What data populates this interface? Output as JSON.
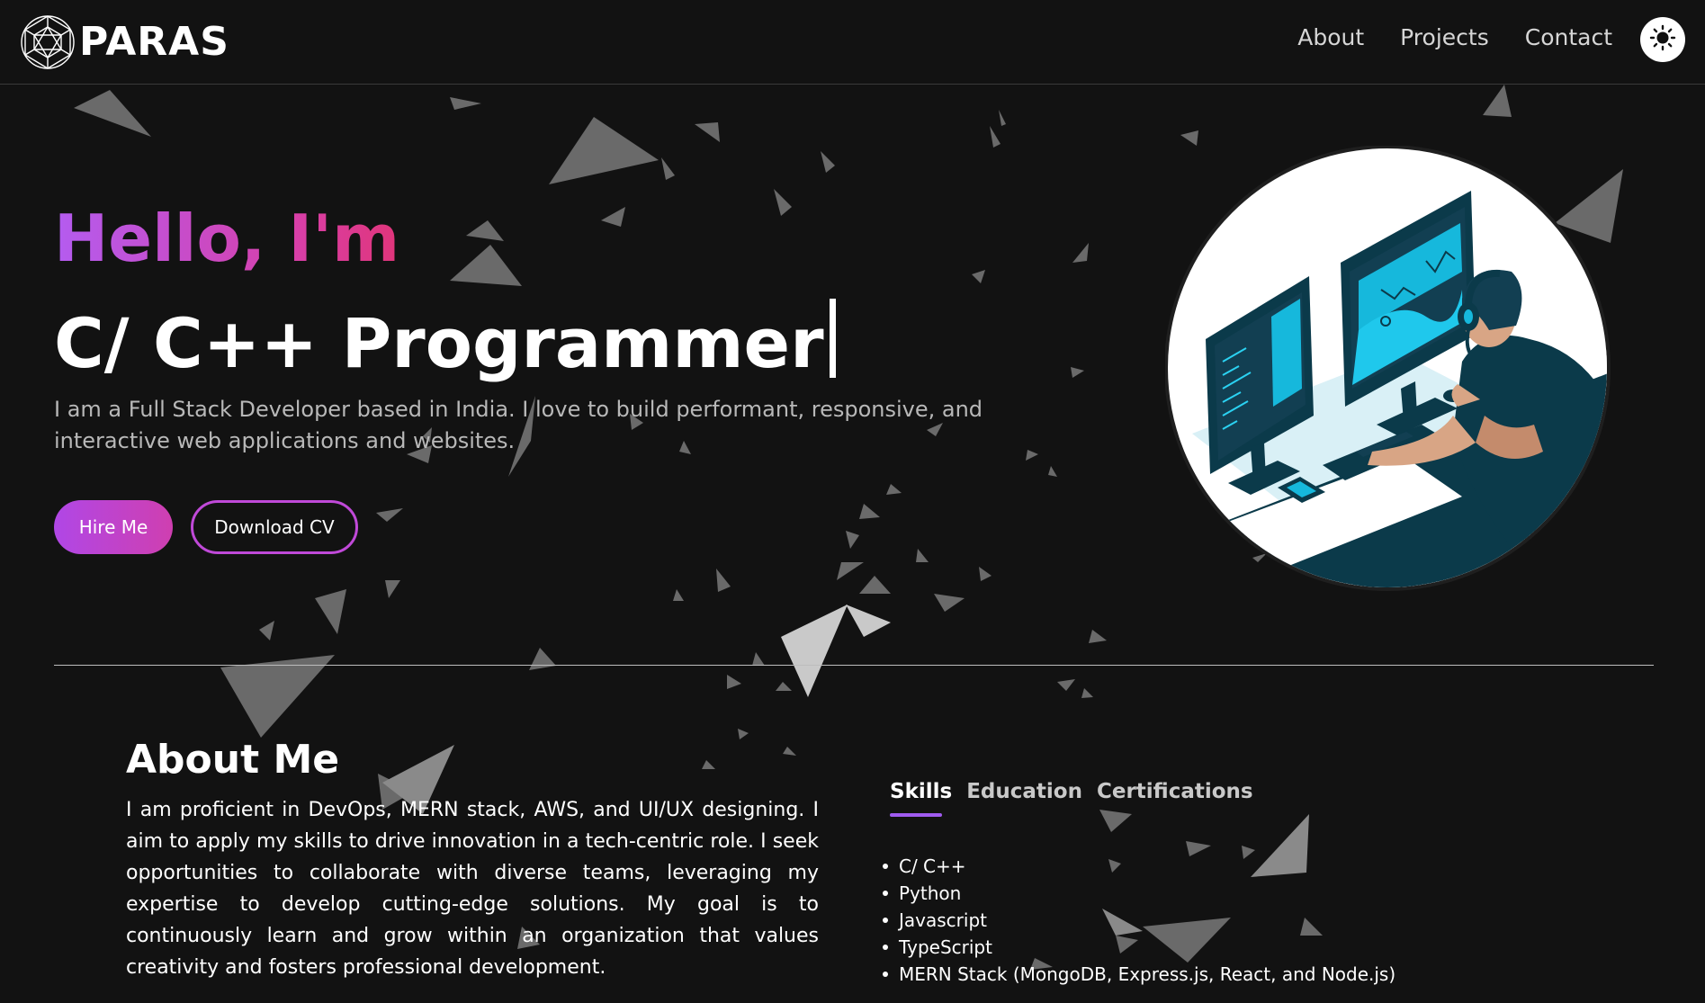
{
  "nav": {
    "logo_text": "PARAS",
    "links": [
      "About",
      "Projects",
      "Contact"
    ],
    "theme_toggle_icon": "sun-icon"
  },
  "hero": {
    "greeting": "Hello, I'm",
    "role": "C/ C++ Programmer",
    "description": "I am a Full Stack Developer based in India. I love to build performant, responsive, and interactive web applications and websites.",
    "hire_button": "Hire Me",
    "cv_button": "Download CV",
    "illustration_icon": "developer-at-desk-illustration"
  },
  "about": {
    "title": "About Me",
    "text": "I am proficient in DevOps, MERN stack, AWS, and UI/UX designing. I aim to apply my skills to drive innovation in a tech-centric role. I seek opportunities to collaborate with diverse teams, leveraging my expertise to develop cutting-edge solutions. My goal is to continuously learn and grow within an organization that values creativity and fosters professional development."
  },
  "tabs": {
    "items": [
      "Skills",
      "Education",
      "Certifications"
    ],
    "active": "Skills",
    "skills": [
      "C/ C++",
      "Python",
      "Javascript",
      "TypeScript",
      "MERN Stack (MongoDB, Express.js, React, and Node.js)"
    ]
  },
  "colors": {
    "background": "#121212",
    "accent_purple": "#b047e6",
    "accent_pink": "#cf3fb0",
    "text_muted": "#b8b8b8",
    "illustration_teal": "#0b3a4a",
    "illustration_cyan": "#16b8dc"
  }
}
